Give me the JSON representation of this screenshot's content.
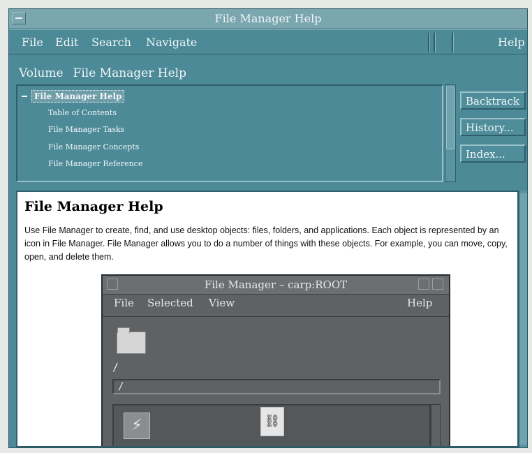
{
  "window": {
    "title": "File Manager Help"
  },
  "menubar": {
    "file": "File",
    "edit": "Edit",
    "search": "Search",
    "navigate": "Navigate",
    "help": "Help"
  },
  "volume": {
    "label": "Volume",
    "name": "File Manager Help"
  },
  "topics": {
    "selected": "File Manager Help",
    "items": [
      "Table of Contents",
      "File Manager Tasks",
      "File Manager Concepts",
      "File Manager Reference"
    ]
  },
  "buttons": {
    "backtrack": "Backtrack",
    "history": "History...",
    "index": "Index..."
  },
  "content": {
    "heading": "File Manager Help",
    "paragraph": "Use File Manager to create, find, and use desktop objects: files, folders, and applications. Each object is represented by an icon in File Manager. File Manager allows you to do a number of things with these objects. For example, you can move, copy, open, and delete them."
  },
  "screenshot": {
    "title": "File Manager – carp:ROOT",
    "menu": {
      "file": "File",
      "selected": "Selected",
      "view": "View",
      "help": "Help"
    },
    "path_label": "/",
    "path_value": "/"
  },
  "colors": {
    "window_bg": "#4c8a98",
    "titlebar": "#7aa6b0",
    "content_bg": "#ffffff",
    "embedded_window": "#5e6265"
  }
}
